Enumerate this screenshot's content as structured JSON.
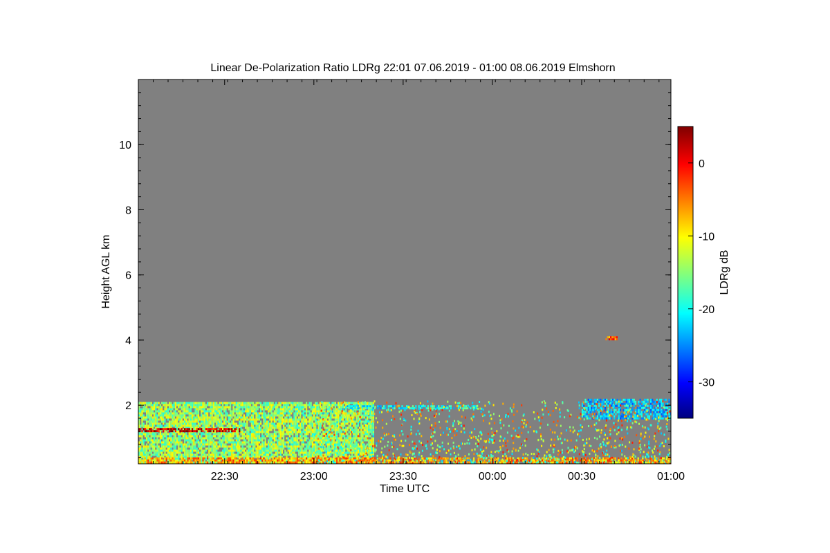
{
  "chart_data": {
    "type": "heatmap",
    "title": "Linear De-Polarization Ratio LDRg   22:01 07.06.2019 - 01:00 08.06.2019 Elmshorn",
    "xlabel": "Time UTC",
    "ylabel": "Height AGL km",
    "colorbar_label": "LDRg dB",
    "x_ticks": [
      {
        "label": "22:30",
        "value": 1350
      },
      {
        "label": "23:00",
        "value": 1380
      },
      {
        "label": "23:30",
        "value": 1410
      },
      {
        "label": "00:00",
        "value": 1440
      },
      {
        "label": "00:30",
        "value": 1470
      },
      {
        "label": "01:00",
        "value": 1500
      }
    ],
    "x_range_minutes": [
      1321,
      1500
    ],
    "y_ticks": [
      2,
      4,
      6,
      8,
      10
    ],
    "y_range": [
      0.2,
      12
    ],
    "colorbar_ticks": [
      0,
      -10,
      -20,
      -30
    ],
    "colorbar_range": [
      -35,
      5
    ],
    "colormap": "jet",
    "no_signal_color": "#808080",
    "layers": [
      {
        "time_start": 1321,
        "time_end": 1400,
        "height_bottom": 0.25,
        "height_top": 2.1,
        "ldr_db": -14
      },
      {
        "time_start": 1321,
        "time_end": 1355,
        "height_bottom": 1.2,
        "height_top": 1.3,
        "ldr_db": 2
      },
      {
        "time_start": 1321,
        "time_end": 1500,
        "height_bottom": 0.25,
        "height_top": 0.4,
        "ldr_db": -6
      },
      {
        "time_start": 1390,
        "time_end": 1435,
        "height_bottom": 1.9,
        "height_top": 2.0,
        "ldr_db": -20
      },
      {
        "time_start": 1470,
        "time_end": 1500,
        "height_bottom": 1.6,
        "height_top": 2.2,
        "ldr_db": -22
      },
      {
        "time_start": 1478,
        "time_end": 1482,
        "height_bottom": 4.05,
        "height_top": 4.12,
        "ldr_db": -4
      }
    ]
  }
}
